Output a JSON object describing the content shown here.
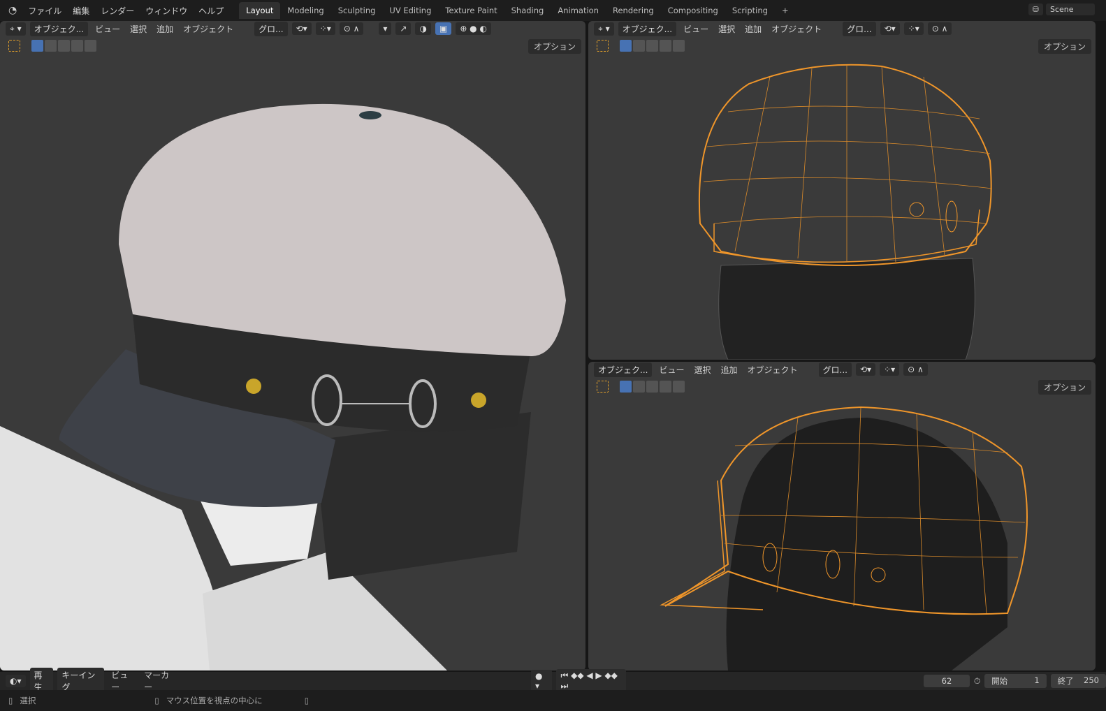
{
  "menu": {
    "items": [
      "ファイル",
      "編集",
      "レンダー",
      "ウィンドウ",
      "ヘルプ"
    ]
  },
  "workspaces": [
    "Layout",
    "Modeling",
    "Sculpting",
    "UV Editing",
    "Texture Paint",
    "Shading",
    "Animation",
    "Rendering",
    "Compositing",
    "Scripting"
  ],
  "add_tab": "+",
  "scene": {
    "name": "Scene"
  },
  "viewport_header": {
    "mode": "オブジェク...",
    "view": "ビュー",
    "select": "選択",
    "add": "追加",
    "object": "オブジェクト",
    "transform": "グロ...",
    "options": "オプション"
  },
  "timeline": {
    "playback": "再生",
    "keying": "キーイング",
    "view": "ビュー",
    "marker": "マーカー",
    "current_frame": "62",
    "start_label": "開始",
    "start": "1",
    "end_label": "終了",
    "end": "250"
  },
  "status": {
    "left": "選択",
    "middle": "マウス位置を視点の中心に"
  },
  "colors": {
    "accent": "#4772b3",
    "wire": "#f0962a"
  }
}
